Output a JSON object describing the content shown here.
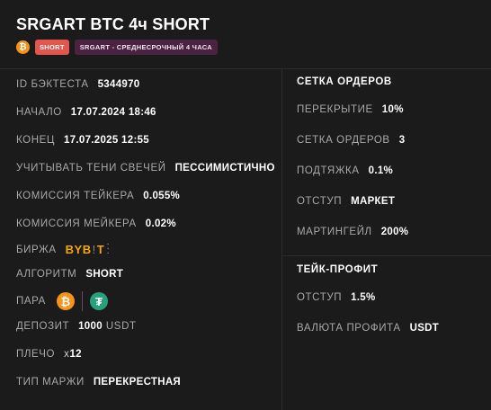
{
  "header": {
    "title": "SRGART BTC 4ч SHORT",
    "coin_icon": "bitcoin-icon",
    "badge_short": "SHORT",
    "badge_strategy": "SRGART - СРЕДНЕСРОЧНЫЙ 4 ЧАСА"
  },
  "left": {
    "id": {
      "label": "ID БЭКТЕСТА",
      "value": "5344970"
    },
    "start": {
      "label": "НАЧАЛО",
      "value": "17.07.2024 18:46"
    },
    "end": {
      "label": "КОНЕЦ",
      "value": "17.07.2025 12:55"
    },
    "shadows": {
      "label": "УЧИТЫВАТЬ ТЕНИ СВЕЧЕЙ",
      "value": "ПЕССИМИСТИЧНО"
    },
    "taker": {
      "label": "КОМИССИЯ ТЕЙКЕРА",
      "value": "0.055%"
    },
    "maker": {
      "label": "КОМИССИЯ МЕЙКЕРА",
      "value": "0.02%"
    },
    "exchange": {
      "label": "БИРЖА",
      "logo_main": "BYB",
      "logo_sep": "!",
      "logo_end": "T",
      "logo_icon": "bybit-logo"
    },
    "algorithm": {
      "label": "АЛГОРИТМ",
      "value": "SHORT"
    },
    "pair": {
      "label": "ПАРА",
      "base_icon": "bitcoin-icon",
      "quote_icon": "tether-icon",
      "base_symbol": "₿",
      "quote_symbol": "₮"
    },
    "deposit": {
      "label": "ДЕПОЗИТ",
      "value": "1000",
      "unit": "USDT"
    },
    "leverage": {
      "label": "ПЛЕЧО",
      "prefix": "x",
      "value": "12"
    },
    "margin": {
      "label": "ТИП МАРЖИ",
      "value": "ПЕРЕКРЕСТНАЯ"
    }
  },
  "grid": {
    "title": "СЕТКА ОРДЕРОВ",
    "overlap": {
      "label": "ПЕРЕКРЫТИЕ",
      "value": "10%"
    },
    "orders": {
      "label": "СЕТКА ОРДЕРОВ",
      "value": "3"
    },
    "pullup": {
      "label": "ПОДТЯЖКА",
      "value": "0.1%"
    },
    "offset": {
      "label": "ОТСТУП",
      "value": "МАРКЕТ"
    },
    "martingale": {
      "label": "МАРТИНГЕЙЛ",
      "value": "200%"
    }
  },
  "takeprofit": {
    "title": "ТЕЙК-ПРОФИТ",
    "offset": {
      "label": "ОТСТУП",
      "value": "1.5%"
    },
    "currency": {
      "label": "ВАЛЮТА ПРОФИТА",
      "value": "USDT"
    }
  },
  "colors": {
    "background": "#1b1b1b",
    "bitcoin": "#f7931a",
    "tether": "#26a17b",
    "short_badge": "#e2564e",
    "strategy_badge": "#4b2342",
    "bybit": "#f7a600"
  }
}
